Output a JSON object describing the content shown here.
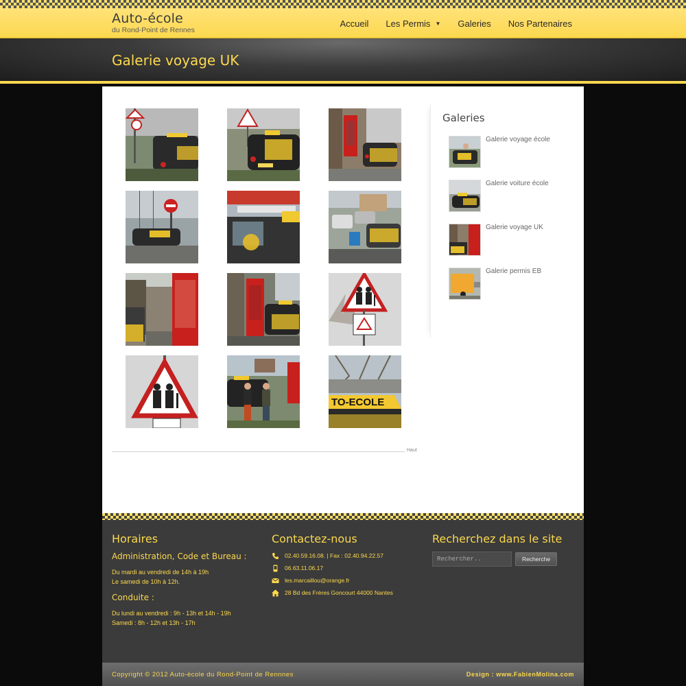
{
  "site": {
    "title": "Auto-école",
    "subtitle": "du Rond-Point de Rennes"
  },
  "nav": {
    "items": [
      {
        "label": "Accueil"
      },
      {
        "label": "Les Permis",
        "has_dropdown": true
      },
      {
        "label": "Galeries"
      },
      {
        "label": "Nos Partenaires"
      }
    ]
  },
  "page": {
    "title": "Galerie voyage UK",
    "top_link": "Haut"
  },
  "gallery": {
    "photos": [
      {
        "subject": "road-sign-car"
      },
      {
        "subject": "car-warning-sign"
      },
      {
        "subject": "car-phone-box"
      },
      {
        "subject": "no-entry-car"
      },
      {
        "subject": "car-auto-sign"
      },
      {
        "subject": "parking-cars"
      },
      {
        "subject": "phone-box-lane"
      },
      {
        "subject": "phone-box-car"
      },
      {
        "subject": "elderly-sign"
      },
      {
        "subject": "elderly-sign-close"
      },
      {
        "subject": "people-car"
      },
      {
        "subject": "auto-ecole-roof-sign"
      }
    ]
  },
  "sidebar": {
    "title": "Galeries",
    "items": [
      {
        "label": "Galerie voyage école"
      },
      {
        "label": "Galerie voiture école"
      },
      {
        "label": "Galerie voyage UK"
      },
      {
        "label": "Galerie permis EB"
      }
    ]
  },
  "footer": {
    "horaires": {
      "title": "Horaires",
      "admin_title": "Administration, Code et Bureau :",
      "admin_lines": [
        "Du mardi au vendredi de 14h à 19h",
        "Le samedi de 10h à 12h."
      ],
      "conduite_title": "Conduite :",
      "conduite_lines": [
        "Du lundi au vendredi : 9h - 13h et 14h - 19h",
        "Samedi : 8h - 12h et 13h - 17h"
      ]
    },
    "contact": {
      "title": "Contactez-nous",
      "phone": "02.40.59.16.08. | Fax : 02.40.94.22.57",
      "mobile": "06.63.11.06.17",
      "email": "les.marcaillou@orange.fr",
      "address": "28 Bd des Frères Goncourt 44000 Nantes"
    },
    "search": {
      "title": "Recherchez dans le site",
      "placeholder": "Rechercher..",
      "button": "Recherche"
    },
    "copyright": "Copyright © 2012 Auto-école du Rond-Point de Rennnes",
    "design": "Design : www.FabienMolina.com"
  },
  "colors": {
    "accent": "#fcd84e",
    "dark": "#3b3b3b"
  }
}
